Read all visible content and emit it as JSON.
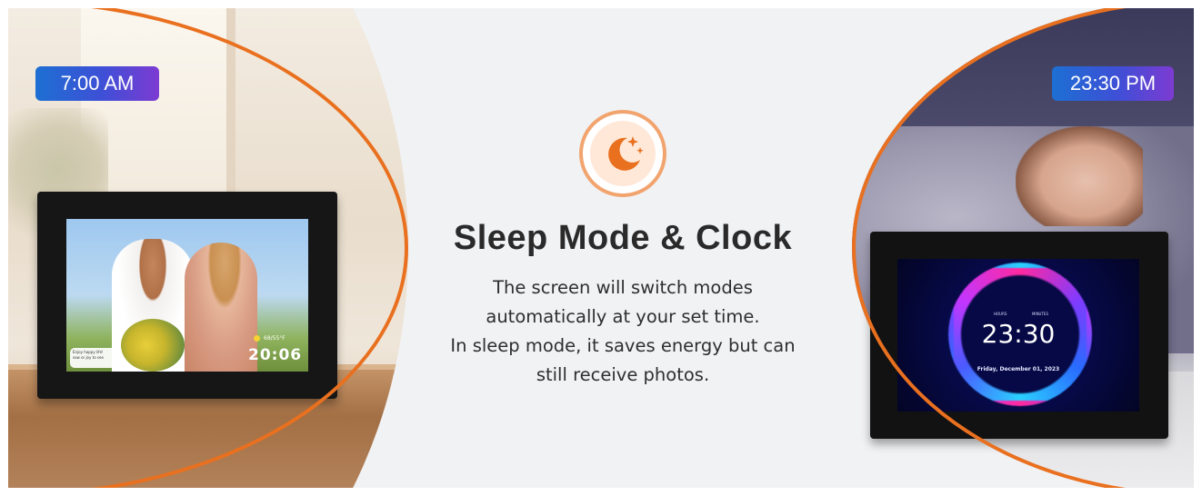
{
  "badges": {
    "morning_time": "7:00 AM",
    "night_time": "23:30 PM"
  },
  "left_frame": {
    "caption_line1": "Enjoy happy life!",
    "caption_line2": "sow or joy to see",
    "weather": "68/55°F",
    "time": "20:06"
  },
  "right_frame": {
    "label_hours": "HOURS",
    "label_minutes": "MINUTES",
    "time": "23:30",
    "date": "Friday, December 01, 2023"
  },
  "center": {
    "icon": "moon-stars-icon",
    "title": "Sleep Mode & Clock",
    "description_lines": [
      "The screen will switch modes",
      "automatically at your set time.",
      "In sleep mode, it saves energy but can",
      "still receive photos."
    ]
  },
  "colors": {
    "accent_orange": "#e9701f",
    "badge_gradient_start": "#1d6fd3",
    "badge_gradient_end": "#7d3bd2",
    "background": "#f1f2f4"
  }
}
